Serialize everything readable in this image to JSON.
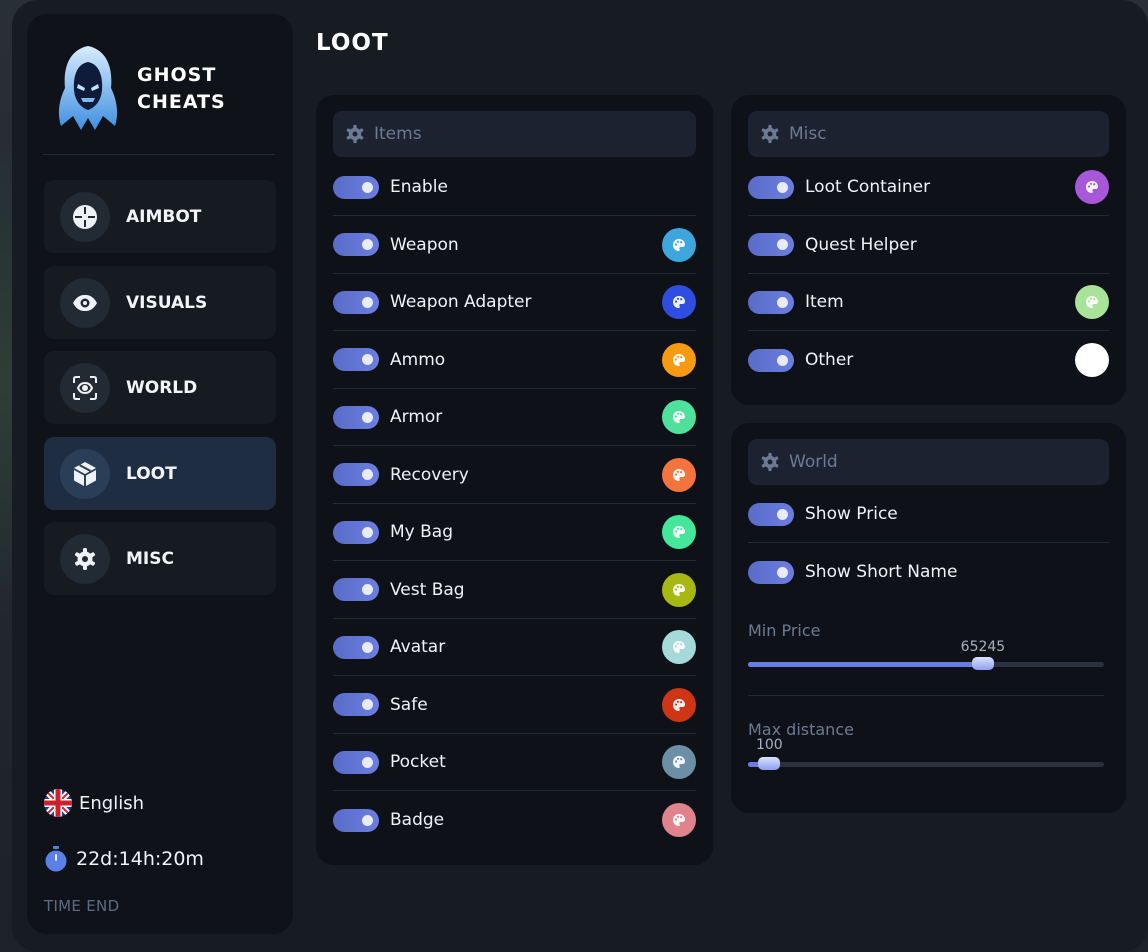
{
  "brand": {
    "line1": "GHOST",
    "line2": "CHEATS"
  },
  "page_title": "LOOT",
  "nav": [
    {
      "label": "AIMBOT",
      "icon": "crosshair-icon",
      "active": false
    },
    {
      "label": "VISUALS",
      "icon": "eye-icon",
      "active": false
    },
    {
      "label": "WORLD",
      "icon": "scan-eye-icon",
      "active": false
    },
    {
      "label": "LOOT",
      "icon": "box-icon",
      "active": true
    },
    {
      "label": "MISC",
      "icon": "gear-icon",
      "active": false
    }
  ],
  "language": {
    "label": "English",
    "icon": "uk-flag-icon"
  },
  "timer": {
    "value": "22d:14h:20m",
    "caption": "TIME END"
  },
  "items_panel": {
    "title": "Items",
    "rows": [
      {
        "label": "Enable",
        "enabled": true,
        "color": null
      },
      {
        "label": "Weapon",
        "enabled": true,
        "color": "#3ea6dc"
      },
      {
        "label": "Weapon Adapter",
        "enabled": true,
        "color": "#2f4ee0"
      },
      {
        "label": "Ammo",
        "enabled": true,
        "color": "#f59a12"
      },
      {
        "label": "Armor",
        "enabled": true,
        "color": "#4fe09b"
      },
      {
        "label": "Recovery",
        "enabled": true,
        "color": "#f47440"
      },
      {
        "label": "My Bag",
        "enabled": true,
        "color": "#44e69a"
      },
      {
        "label": "Vest Bag",
        "enabled": true,
        "color": "#a8b812"
      },
      {
        "label": "Avatar",
        "enabled": true,
        "color": "#a6dada"
      },
      {
        "label": "Safe",
        "enabled": true,
        "color": "#cf3415"
      },
      {
        "label": "Pocket",
        "enabled": true,
        "color": "#6d8fa6"
      },
      {
        "label": "Badge",
        "enabled": true,
        "color": "#e0838c"
      }
    ]
  },
  "misc_panel": {
    "title": "Misc",
    "rows": [
      {
        "label": "Loot Container",
        "enabled": true,
        "color": "#a658d8"
      },
      {
        "label": "Quest Helper",
        "enabled": true,
        "color": null
      },
      {
        "label": "Item",
        "enabled": true,
        "color": "#a9e39a"
      },
      {
        "label": "Other",
        "enabled": true,
        "color": "#ffffff"
      }
    ]
  },
  "world_panel": {
    "title": "World",
    "rows": [
      {
        "label": "Show Price",
        "enabled": true
      },
      {
        "label": "Show Short Name",
        "enabled": true
      }
    ],
    "sliders": [
      {
        "label": "Min Price",
        "value": "65245",
        "fraction": 0.66
      },
      {
        "label": "Max distance",
        "value": "100",
        "fraction": 0.06
      }
    ]
  }
}
